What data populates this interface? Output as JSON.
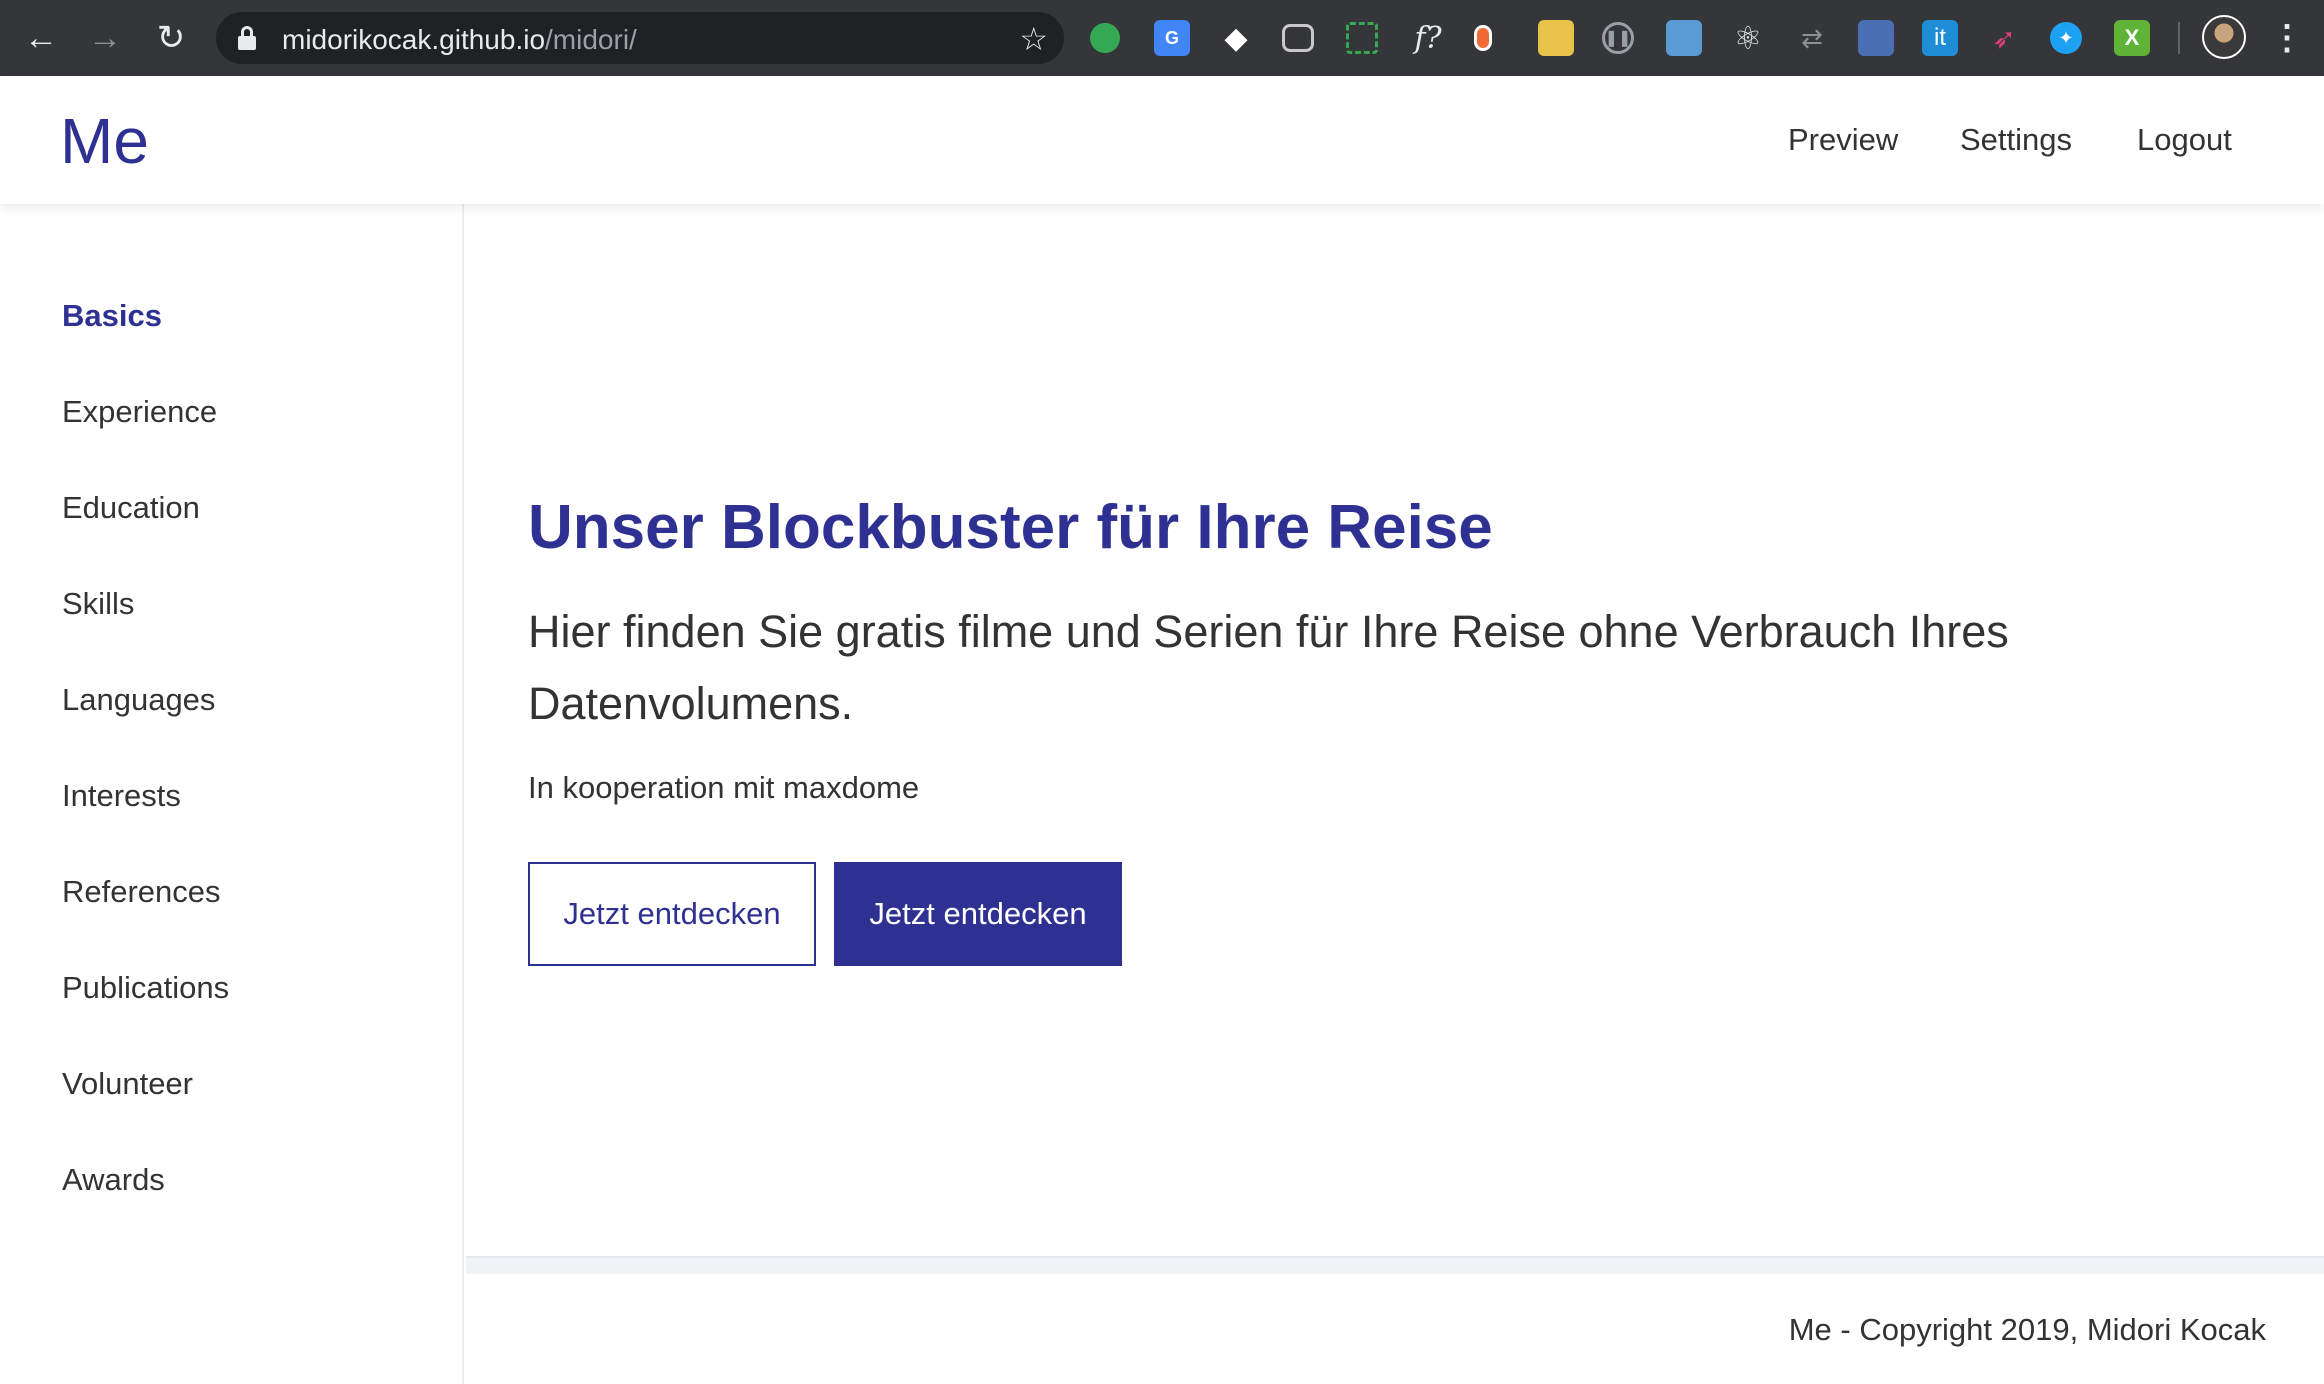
{
  "browser": {
    "url_host": "midorikocak.github.io",
    "url_path": "/midori/",
    "extensions": [
      "evernote-icon",
      "translate-icon",
      "gem-icon",
      "pocket-icon",
      "screenshot-icon",
      "font-icon",
      "pencil-icon",
      "folder-icon",
      "pause-icon",
      "window-icon",
      "react-icon",
      "sync-icon",
      "calendar-icon",
      "it-icon",
      "hummingbird-icon",
      "twitter-icon",
      "excel-icon"
    ],
    "icons": {
      "back": "←",
      "forward": "→",
      "reload": "↻",
      "star": "☆",
      "menu": "⋮"
    }
  },
  "header": {
    "logo": "Me",
    "nav": {
      "preview": "Preview",
      "settings": "Settings",
      "logout": "Logout"
    }
  },
  "sidebar": {
    "items": [
      {
        "label": "Basics",
        "active": true
      },
      {
        "label": "Experience"
      },
      {
        "label": "Education"
      },
      {
        "label": "Skills"
      },
      {
        "label": "Languages"
      },
      {
        "label": "Interests"
      },
      {
        "label": "References"
      },
      {
        "label": "Publications"
      },
      {
        "label": "Volunteer"
      },
      {
        "label": "Awards"
      }
    ]
  },
  "hero": {
    "title_strong": "Unser Blockbuster",
    "title_rest": " für Ihre Reise",
    "subtitle": "Hier finden Sie gratis filme und Serien für Ihre Reise ohne Verbrauch Ihres Datenvolumens.",
    "note": "In kooperation mit maxdome",
    "button_outline": "Jetzt entdecken",
    "button_solid": "Jetzt entdecken"
  },
  "footer": {
    "text": "Me - Copyright 2019, Midori Kocak"
  },
  "colors": {
    "accent": "#2e3192",
    "chrome": "#35363a",
    "omnibox": "#202124"
  }
}
